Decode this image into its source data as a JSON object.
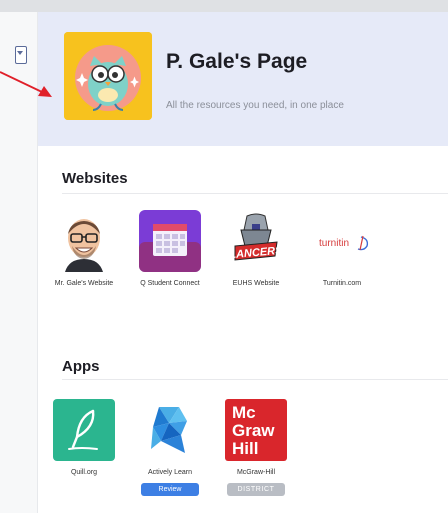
{
  "page": {
    "title": "P. Gale's Page",
    "subtitle": "All the resources you need, in one place"
  },
  "sections": {
    "websites": {
      "heading": "Websites",
      "items": [
        {
          "label": "Mr. Gale's Website",
          "icon": "bitmoji-avatar-icon"
        },
        {
          "label": "Q Student Connect",
          "icon": "calendar-icon"
        },
        {
          "label": "EUHS Website",
          "icon": "lancers-logo-icon"
        },
        {
          "label": "Turnitin.com",
          "icon": "turnitin-logo-icon",
          "logo_text": "turnitin"
        }
      ]
    },
    "apps": {
      "heading": "Apps",
      "items": [
        {
          "label": "Quill.org",
          "icon": "quill-icon"
        },
        {
          "label": "Actively Learn",
          "icon": "actively-learn-icon",
          "badge": "Review"
        },
        {
          "label": "McGraw-Hill",
          "icon": "mcgraw-hill-icon",
          "badge": "DISTRICT",
          "logo_lines": [
            "Mc",
            "Graw",
            "Hill"
          ]
        }
      ]
    }
  },
  "colors": {
    "header_bg": "#e6eaf8",
    "accent_blue": "#3d7fe4",
    "quill_green": "#2bb58f",
    "mcgraw_red": "#d9262c",
    "calendar_purple": "#7b3cd6"
  }
}
